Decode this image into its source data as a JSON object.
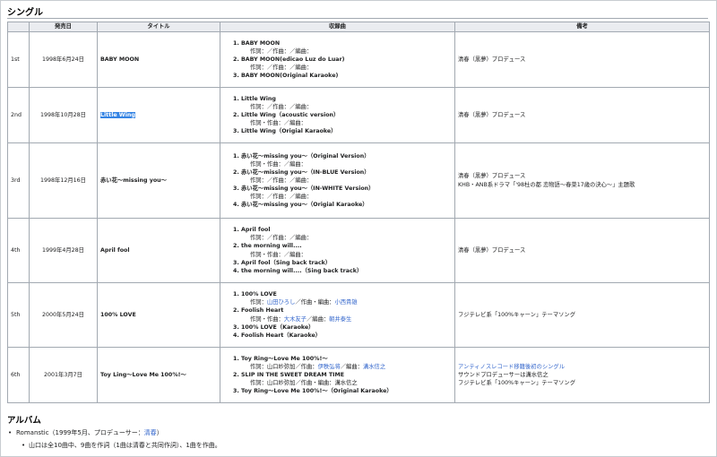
{
  "singles_heading": "シングル",
  "columns": [
    "発売日",
    "タイトル",
    "収録曲",
    "備考"
  ],
  "singles": [
    {
      "no": "1st",
      "date": "1998年6月24日",
      "title": "BABY MOON",
      "tracks": [
        {
          "name": "BABY MOON",
          "credit": "作詞：／作曲：／編曲："
        },
        {
          "name": "BABY MOON(edicao Luz do Luar)",
          "credit": "作詞：／作曲：／編曲："
        },
        {
          "name": "BABY MOON(Original Karaoke)",
          "credit": ""
        }
      ],
      "remarks": [
        "清春（黒夢）プロデュース"
      ]
    },
    {
      "no": "2nd",
      "date": "1998年10月28日",
      "title": "Little Wing",
      "tracks": [
        {
          "name": "Little Wing",
          "credit": "作詞：／作曲：／編曲："
        },
        {
          "name": "Little Wing（acoustic version）",
          "credit": "作詞・作曲：／編曲："
        },
        {
          "name": "Little Wing（Origial Karaoke）",
          "credit": ""
        }
      ],
      "remarks": [
        "清春（黒夢）プロデュース"
      ]
    },
    {
      "no": "3rd",
      "date": "1998年12月16日",
      "title": "赤い花〜missing you〜",
      "tracks": [
        {
          "name": "赤い花〜missing you〜（Original Version）",
          "credit": "作詞・作曲：／編曲："
        },
        {
          "name": "赤い花〜missing you〜（IN-BLUE Version）",
          "credit": "作詞：／作曲：／編曲："
        },
        {
          "name": "赤い花〜missing you〜（IN-WHITE Version）",
          "credit": "作詞：／作曲：／編曲："
        },
        {
          "name": "赤い花〜missing you〜（Origial Karaoke）",
          "credit": ""
        }
      ],
      "remarks": [
        "清春（黒夢）プロデュース",
        "KHB・ANB系ドラマ「'98杜の都 恋物語〜春菜17歳の決心〜」主題歌"
      ]
    },
    {
      "no": "4th",
      "date": "1999年4月28日",
      "title": "April fool",
      "tracks": [
        {
          "name": "April fool",
          "credit": "作詞：／作曲：／編曲："
        },
        {
          "name": "the morning will....",
          "credit": "作詞・作曲：／編曲："
        },
        {
          "name": "April fool（Sing back track）",
          "credit": ""
        },
        {
          "name": "the morning will....（Sing back track）",
          "credit": ""
        }
      ],
      "remarks": [
        "清春（黒夢）プロデュース"
      ]
    },
    {
      "no": "5th",
      "date": "2000年5月24日",
      "title": "100% LOVE",
      "tracks": [
        {
          "name": "100% LOVE",
          "credit": "作詞：山田ひろし／作曲・編曲：小西貴雄"
        },
        {
          "name": "Foolish Heart",
          "credit": "作詞・作曲：大木友子／編曲：朝井泰生"
        },
        {
          "name": "100% LOVE（Karaoke）",
          "credit": ""
        },
        {
          "name": "Foolish Heart（Karaoke）",
          "credit": ""
        }
      ],
      "remarks": [
        "フジテレビ系「100%キャーン」テーマソング"
      ]
    },
    {
      "no": "6th",
      "date": "2001年3月7日",
      "title": "Toy Ling〜Love Me 100%!〜",
      "tracks": [
        {
          "name": "Toy Ring〜Love Me 100%!〜",
          "credit": "作詞：山口紗弥加／作曲：伊秩弘将／編曲：溝水信之"
        },
        {
          "name": "SLIP IN THE SWEET DREAM TIME",
          "credit": "作詞：山口紗弥加／作曲・編曲：溝水信之"
        },
        {
          "name": "Toy Ring〜Love Me 100%!〜（Original Karaoke）",
          "credit": ""
        }
      ],
      "remarks": [
        "アンティノスレコード移籍後初のシングル",
        "サウンドプロデューサーは溝水信之",
        "フジテレビ系「100%キャーン」テーマソング"
      ]
    }
  ],
  "albums_heading": "アルバム",
  "album": {
    "prefix": "Romanstic（1999年5月、プロデューサー：",
    "producer": "清春",
    "suffix": "）",
    "note": "山口は全10曲中、9曲を作詞（1曲は清春と共同作詞）、1曲を作曲。"
  },
  "colors": {
    "link": "#3366cc",
    "selection": "#3584e4",
    "header_bg": "#eaecf0",
    "border": "#a2a9b1"
  }
}
